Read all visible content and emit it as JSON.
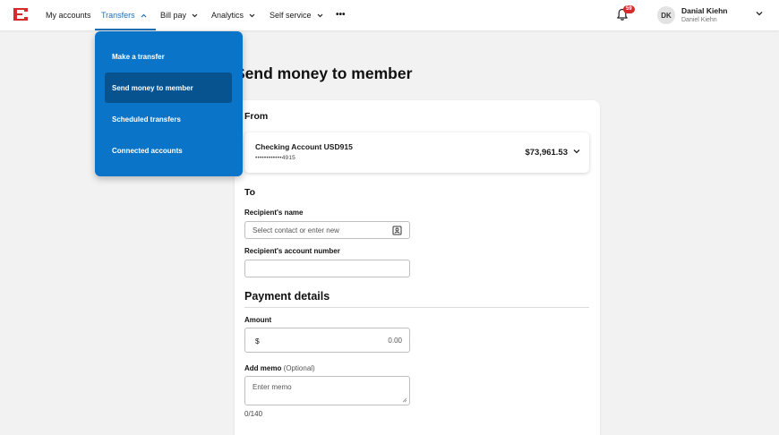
{
  "nav": {
    "items": [
      {
        "label": "My accounts"
      },
      {
        "label": "Transfers"
      },
      {
        "label": "Bill pay"
      },
      {
        "label": "Analytics"
      },
      {
        "label": "Self service"
      }
    ],
    "more": "•••",
    "notification_count": "59",
    "user": {
      "initials": "DK",
      "name": "Danial Kiehn",
      "subname": "Daniel Kiehn"
    },
    "accent_color": "#1f6fb5"
  },
  "transfers_menu": {
    "items": [
      {
        "label": "Make a transfer"
      },
      {
        "label": "Send money to member"
      },
      {
        "label": "Scheduled transfers"
      },
      {
        "label": "Connected accounts"
      }
    ],
    "selected": "Send money to member",
    "bg_color": "#0a74c9"
  },
  "page": {
    "title": "Send money to member",
    "from_label": "From",
    "account": {
      "name": "Checking Account USD915",
      "number": "••••••••••••4915",
      "balance": "$73,961.53"
    },
    "to_label": "To",
    "recipient_name_label": "Recipient's name",
    "recipient_name_placeholder": "Select contact or enter new",
    "recipient_account_label": "Recipient's account number",
    "payment_details_label": "Payment details",
    "amount_label": "Amount",
    "currency_symbol": "$",
    "amount_value": "0.00",
    "memo_label": "Add memo",
    "memo_optional": "(Optional)",
    "memo_placeholder": "Enter memo",
    "memo_counter": "0/140"
  }
}
